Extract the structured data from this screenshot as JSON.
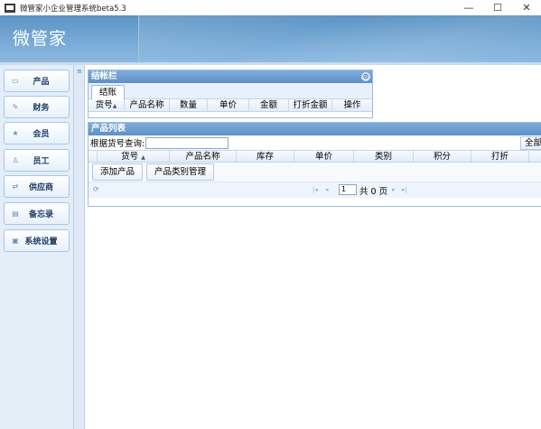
{
  "window": {
    "title": "微管家小企业管理系统beta5.3",
    "minimize": "—",
    "maximize": "☐",
    "close": "✕"
  },
  "app": {
    "logo": "微管家"
  },
  "sidebar": {
    "items": [
      {
        "label": "产品",
        "icon": "▭"
      },
      {
        "label": "财务",
        "icon": "✎"
      },
      {
        "label": "会员",
        "icon": "★"
      },
      {
        "label": "员工",
        "icon": "♙"
      },
      {
        "label": "供应商",
        "icon": "⇄"
      },
      {
        "label": "备忘录",
        "icon": "▤"
      },
      {
        "label": "系统设置",
        "icon": "▣"
      }
    ]
  },
  "checkout_panel": {
    "title": "结帐栏",
    "tab": "结账",
    "columns": [
      "货号",
      "产品名称",
      "数量",
      "单价",
      "金额",
      "打折金额",
      "操作"
    ]
  },
  "product_panel": {
    "title": "产品列表",
    "search_label": "根据货号查询:",
    "search_value": "",
    "all_button": "全部",
    "columns": [
      "货号",
      "产品名称",
      "库存",
      "单价",
      "类别",
      "积分",
      "打折"
    ],
    "add_button": "添加产品",
    "category_button": "产品类别管理",
    "pager": {
      "page": "1",
      "total": "共 0 页"
    }
  }
}
